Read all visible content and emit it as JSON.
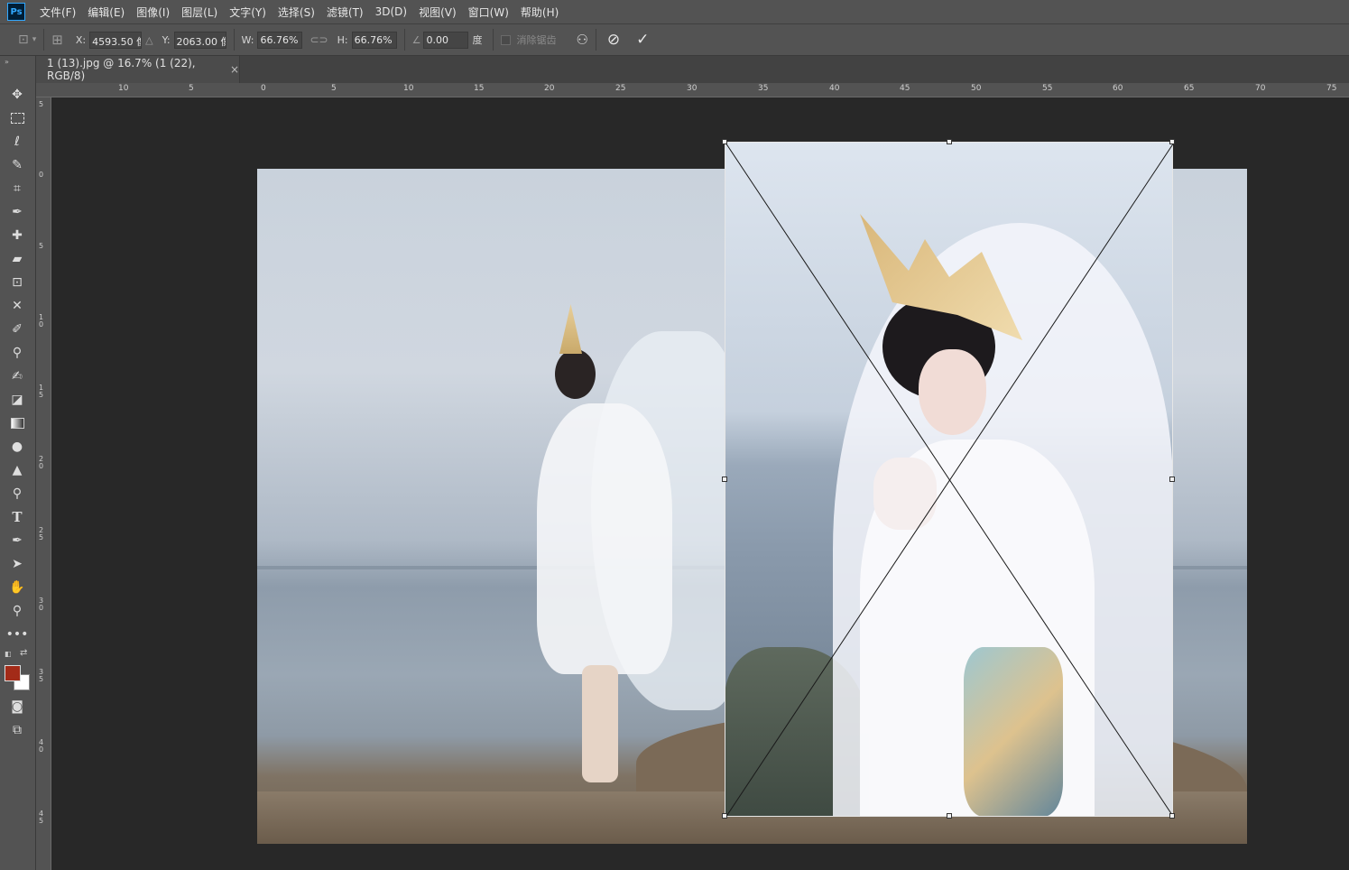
{
  "app": {
    "logo": "Ps"
  },
  "menu": [
    {
      "label": "文件(F)"
    },
    {
      "label": "编辑(E)"
    },
    {
      "label": "图像(I)"
    },
    {
      "label": "图层(L)"
    },
    {
      "label": "文字(Y)"
    },
    {
      "label": "选择(S)"
    },
    {
      "label": "滤镜(T)"
    },
    {
      "label": "3D(D)"
    },
    {
      "label": "视图(V)"
    },
    {
      "label": "窗口(W)"
    },
    {
      "label": "帮助(H)"
    }
  ],
  "options": {
    "x_label": "X:",
    "x_value": "4593.50 像",
    "y_label": "Y:",
    "y_value": "2063.00 像",
    "w_label": "W:",
    "w_value": "66.76%",
    "h_label": "H:",
    "h_value": "66.76%",
    "angle_value": "0.00",
    "angle_unit": "度",
    "antialias_label": "消除锯齿"
  },
  "document_tab": {
    "title": "1 (13).jpg @ 16.7% (1 (22), RGB/8)",
    "close": "×"
  },
  "ruler_h": [
    "10",
    "5",
    "0",
    "5",
    "10",
    "15",
    "20",
    "25",
    "30",
    "35",
    "40",
    "45",
    "50",
    "55",
    "60",
    "65",
    "70",
    "75"
  ],
  "ruler_v": [
    "5",
    "0",
    "5",
    "10",
    "15",
    "20",
    "25",
    "30",
    "35",
    "40",
    "45"
  ],
  "colors": {
    "foreground": "#a32b18",
    "background": "#ffffff",
    "accent": "#31a8ff"
  },
  "tools": [
    "move-icon",
    "marquee-icon",
    "lasso-icon",
    "quick-select-icon",
    "crop-icon",
    "eyedropper-icon",
    "healing-brush-icon",
    "patch-icon",
    "frame-icon",
    "content-aware-move-icon",
    "brush-icon",
    "clone-stamp-icon",
    "history-brush-icon",
    "eraser-icon",
    "gradient-icon",
    "blur-icon",
    "sharpen-icon",
    "dodge-icon",
    "type-icon",
    "pen-icon",
    "path-select-icon",
    "hand-icon",
    "zoom-icon",
    "more-tools-icon",
    "quick-mask-icon",
    "screen-mode-icon"
  ]
}
